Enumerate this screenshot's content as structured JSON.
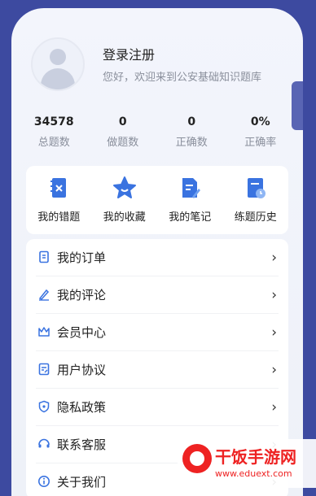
{
  "profile": {
    "login_text": "登录注册",
    "welcome_text": "您好，欢迎来到公安基础知识题库"
  },
  "stats": [
    {
      "value": "34578",
      "label": "总题数"
    },
    {
      "value": "0",
      "label": "做题数"
    },
    {
      "value": "0",
      "label": "正确数"
    },
    {
      "value": "0%",
      "label": "正确率"
    }
  ],
  "quick_actions": [
    {
      "label": "我的错题",
      "icon": "wrong-questions-icon"
    },
    {
      "label": "我的收藏",
      "icon": "star-icon"
    },
    {
      "label": "我的笔记",
      "icon": "notes-icon"
    },
    {
      "label": "练题历史",
      "icon": "history-icon"
    }
  ],
  "menu": [
    {
      "label": "我的订单",
      "icon": "order-icon"
    },
    {
      "label": "我的评论",
      "icon": "comment-icon"
    },
    {
      "label": "会员中心",
      "icon": "crown-icon"
    },
    {
      "label": "用户协议",
      "icon": "agreement-icon"
    },
    {
      "label": "隐私政策",
      "icon": "shield-icon"
    },
    {
      "label": "联系客服",
      "icon": "customer-service-icon"
    },
    {
      "label": "关于我们",
      "icon": "info-icon"
    }
  ],
  "watermark": {
    "title": "干饭手游网",
    "url": "www.eduext.com"
  },
  "colors": {
    "accent": "#3a73e0",
    "background": "#3d4aa0",
    "watermark": "#e22222"
  }
}
